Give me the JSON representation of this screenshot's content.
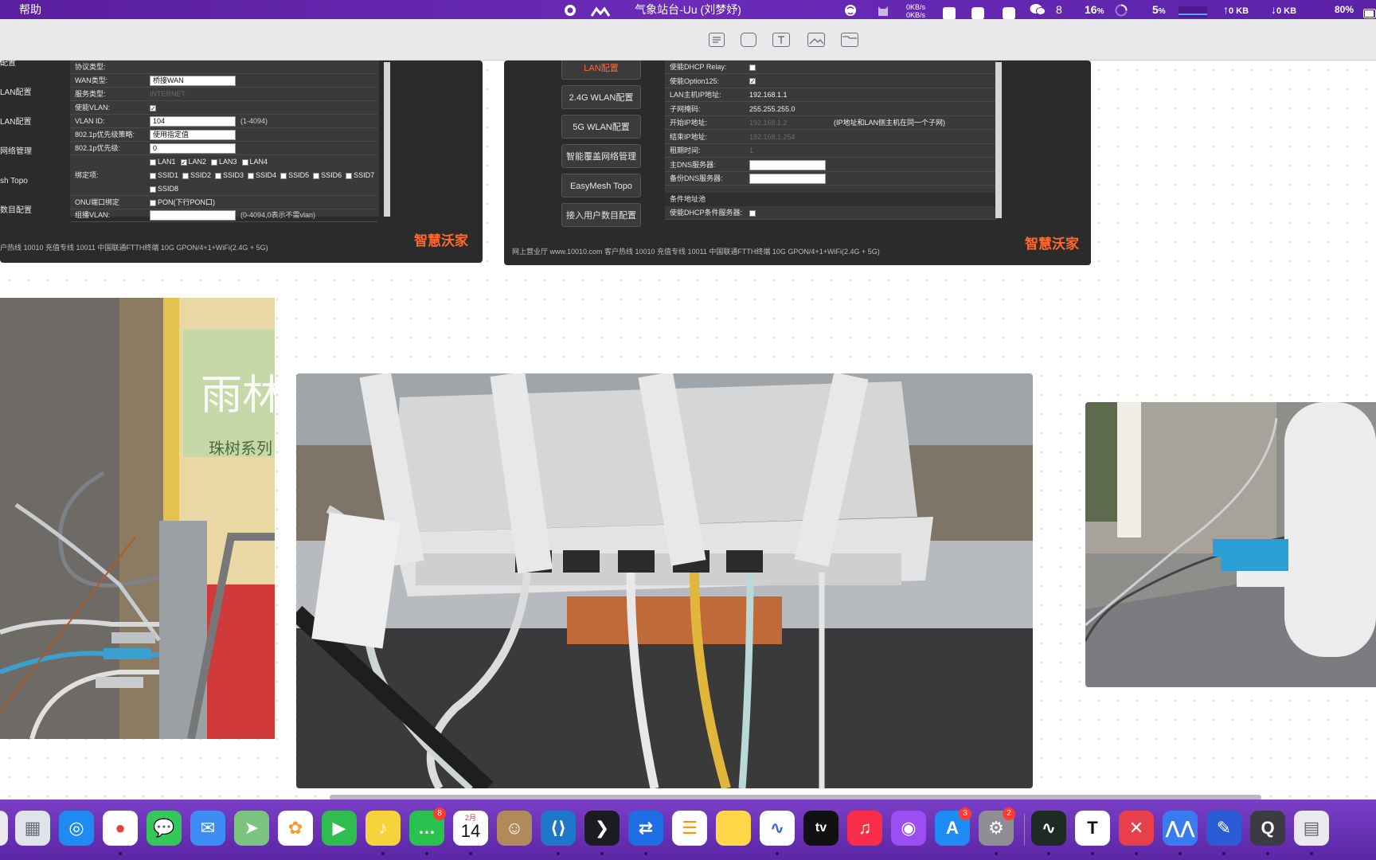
{
  "menubar": {
    "left_menu": "帮助",
    "title": "气象站台-Uu (刘梦妤)",
    "net_up_rate": "0KB/s",
    "net_down_rate": "0KB/s",
    "wechat_count": "8",
    "cpu_percent": "16",
    "cpu_unit": "%",
    "gpu_percent": "5",
    "gpu_unit": "%",
    "upload": "0 KB",
    "download": "0 KB",
    "battery": "80%",
    "up_arrow": "↑",
    "down_arrow": "↓"
  },
  "toolbar": {
    "icons": [
      "note-icon",
      "shapes-icon",
      "text-box-icon",
      "media-icon",
      "folder-icon"
    ]
  },
  "panel_left": {
    "rows": [
      {
        "label": "协议类型:",
        "value": ""
      },
      {
        "label": "WAN类型:",
        "value": "桥接WAN"
      },
      {
        "label": "服务类型:",
        "value": "INTERNET"
      },
      {
        "label": "使能VLAN:",
        "value": "✓"
      },
      {
        "label": "VLAN ID:",
        "value": "104",
        "hint": "(1-4094)"
      },
      {
        "label": "802.1p优先级策略:",
        "value": "使用指定值"
      },
      {
        "label": "802.1p优先级:",
        "value": "0"
      },
      {
        "label": "绑定项:",
        "value": ""
      },
      {
        "label": "ONU端口绑定",
        "value": "PON(下行PON口)"
      },
      {
        "label": "组播VLAN:",
        "value": "",
        "hint": "(0-4094,0表示不需vlan)"
      }
    ],
    "bind_ports": [
      "LAN1",
      "LAN2",
      "LAN3",
      "LAN4"
    ],
    "bind_ssids": [
      "SSID1",
      "SSID2",
      "SSID3",
      "SSID4",
      "SSID5",
      "SSID6",
      "SSID7",
      "SSID8"
    ],
    "side_labels": [
      "配置",
      "LAN配置",
      "LAN配置",
      "网络管理",
      "sh Topo",
      "数目配置"
    ],
    "footer": "户热线 10010   充值专线 10011        中国联通FTTH终端 10G GPON/4+1+WiFi(2.4G + 5G)",
    "brand": "智慧沃家"
  },
  "panel_right": {
    "nav": [
      "LAN配置",
      "2.4G WLAN配置",
      "5G WLAN配置",
      "智能覆盖网络管理",
      "EasyMesh Topo",
      "接入用户数目配置"
    ],
    "rows": [
      {
        "label": "使能DHCP Relay:",
        "value": ""
      },
      {
        "label": "使能Option125:",
        "value": "✓"
      },
      {
        "label": "LAN主机IP地址:",
        "value": "192.168.1.1"
      },
      {
        "label": "子网掩码:",
        "value": "255.255.255.0"
      },
      {
        "label": "开始IP地址:",
        "value": "192.168.1.2",
        "hint": "(IP地址和LAN侧主机在同一个子网)"
      },
      {
        "label": "结束IP地址:",
        "value": "192.168.1.254"
      },
      {
        "label": "租期时间:",
        "value": "1"
      },
      {
        "label": "主DNS服务器:",
        "value": ""
      },
      {
        "label": "备份DNS服务器:",
        "value": ""
      }
    ],
    "section": "条件地址池",
    "section_row": "使能DHCP条件服务器:",
    "footer": "网上营业厅 www.10010.com   客户热线 10010   充值专线 10011        中国联通FTTH终端 10G GPON/4+1+WiFi(2.4G + 5G)",
    "brand": "智慧沃家"
  },
  "photo_left": {
    "sign_text": "雨林",
    "sign_sub": "珠树系列"
  },
  "dock": {
    "apps": [
      {
        "name": "launchpad",
        "badge": ""
      },
      {
        "name": "safari",
        "badge": ""
      },
      {
        "name": "chrome",
        "badge": ""
      },
      {
        "name": "messages",
        "badge": ""
      },
      {
        "name": "mail",
        "badge": ""
      },
      {
        "name": "maps",
        "badge": ""
      },
      {
        "name": "photos",
        "badge": ""
      },
      {
        "name": "facetime",
        "badge": ""
      },
      {
        "name": "qq-music",
        "badge": ""
      },
      {
        "name": "wechat",
        "badge": "8"
      },
      {
        "name": "calendar",
        "badge": ""
      },
      {
        "name": "contacts",
        "badge": ""
      },
      {
        "name": "vscode",
        "badge": ""
      },
      {
        "name": "prompt",
        "badge": ""
      },
      {
        "name": "remote-desktop",
        "badge": ""
      },
      {
        "name": "reminders",
        "badge": ""
      },
      {
        "name": "notes",
        "badge": ""
      },
      {
        "name": "freeform",
        "badge": ""
      },
      {
        "name": "apple-tv",
        "badge": ""
      },
      {
        "name": "music",
        "badge": ""
      },
      {
        "name": "podcasts",
        "badge": ""
      },
      {
        "name": "app-store",
        "badge": "3"
      },
      {
        "name": "system-settings",
        "badge": "2"
      },
      {
        "name": "activity-monitor",
        "badge": ""
      },
      {
        "name": "typora",
        "badge": ""
      },
      {
        "name": "xmind",
        "badge": ""
      },
      {
        "name": "uu-remote",
        "badge": ""
      },
      {
        "name": "pencil",
        "badge": ""
      },
      {
        "name": "quicktime",
        "badge": ""
      },
      {
        "name": "preview-doc",
        "badge": ""
      }
    ],
    "calendar_month": "2月",
    "calendar_day": "14",
    "tv_label": "tv"
  }
}
